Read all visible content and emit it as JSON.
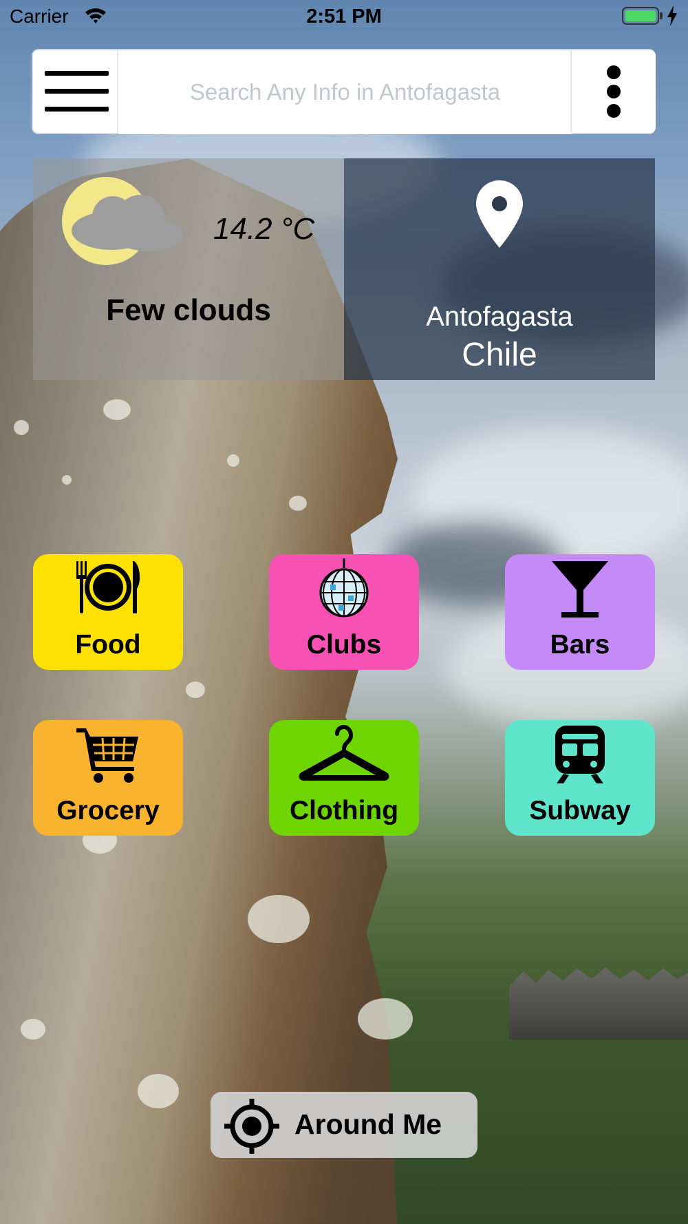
{
  "status_bar": {
    "carrier": "Carrier",
    "time": "2:51 PM",
    "battery_color": "#4cd964"
  },
  "search": {
    "placeholder": "Search Any Info in Antofagasta",
    "menu_icon": "hamburger-menu-icon",
    "more_icon": "vertical-dots-icon"
  },
  "weather": {
    "temperature": "14.2 °C",
    "condition": "Few clouds",
    "icon": "sun-behind-cloud-icon"
  },
  "location": {
    "city": "Antofagasta",
    "country": "Chile",
    "icon": "map-pin-icon"
  },
  "categories": [
    {
      "label": "Food",
      "icon": "plate-fork-knife-icon",
      "color": "#fde100"
    },
    {
      "label": "Clubs",
      "icon": "disco-ball-icon",
      "color": "#f751b4"
    },
    {
      "label": "Bars",
      "icon": "cocktail-glass-icon",
      "color": "#c48af8"
    },
    {
      "label": "Grocery",
      "icon": "shopping-cart-icon",
      "color": "#f9b32e"
    },
    {
      "label": "Clothing",
      "icon": "hanger-icon",
      "color": "#6fd500"
    },
    {
      "label": "Subway",
      "icon": "train-icon",
      "color": "#5ee5cc"
    }
  ],
  "around_me": {
    "label": "Around Me",
    "icon": "crosshair-target-icon"
  }
}
